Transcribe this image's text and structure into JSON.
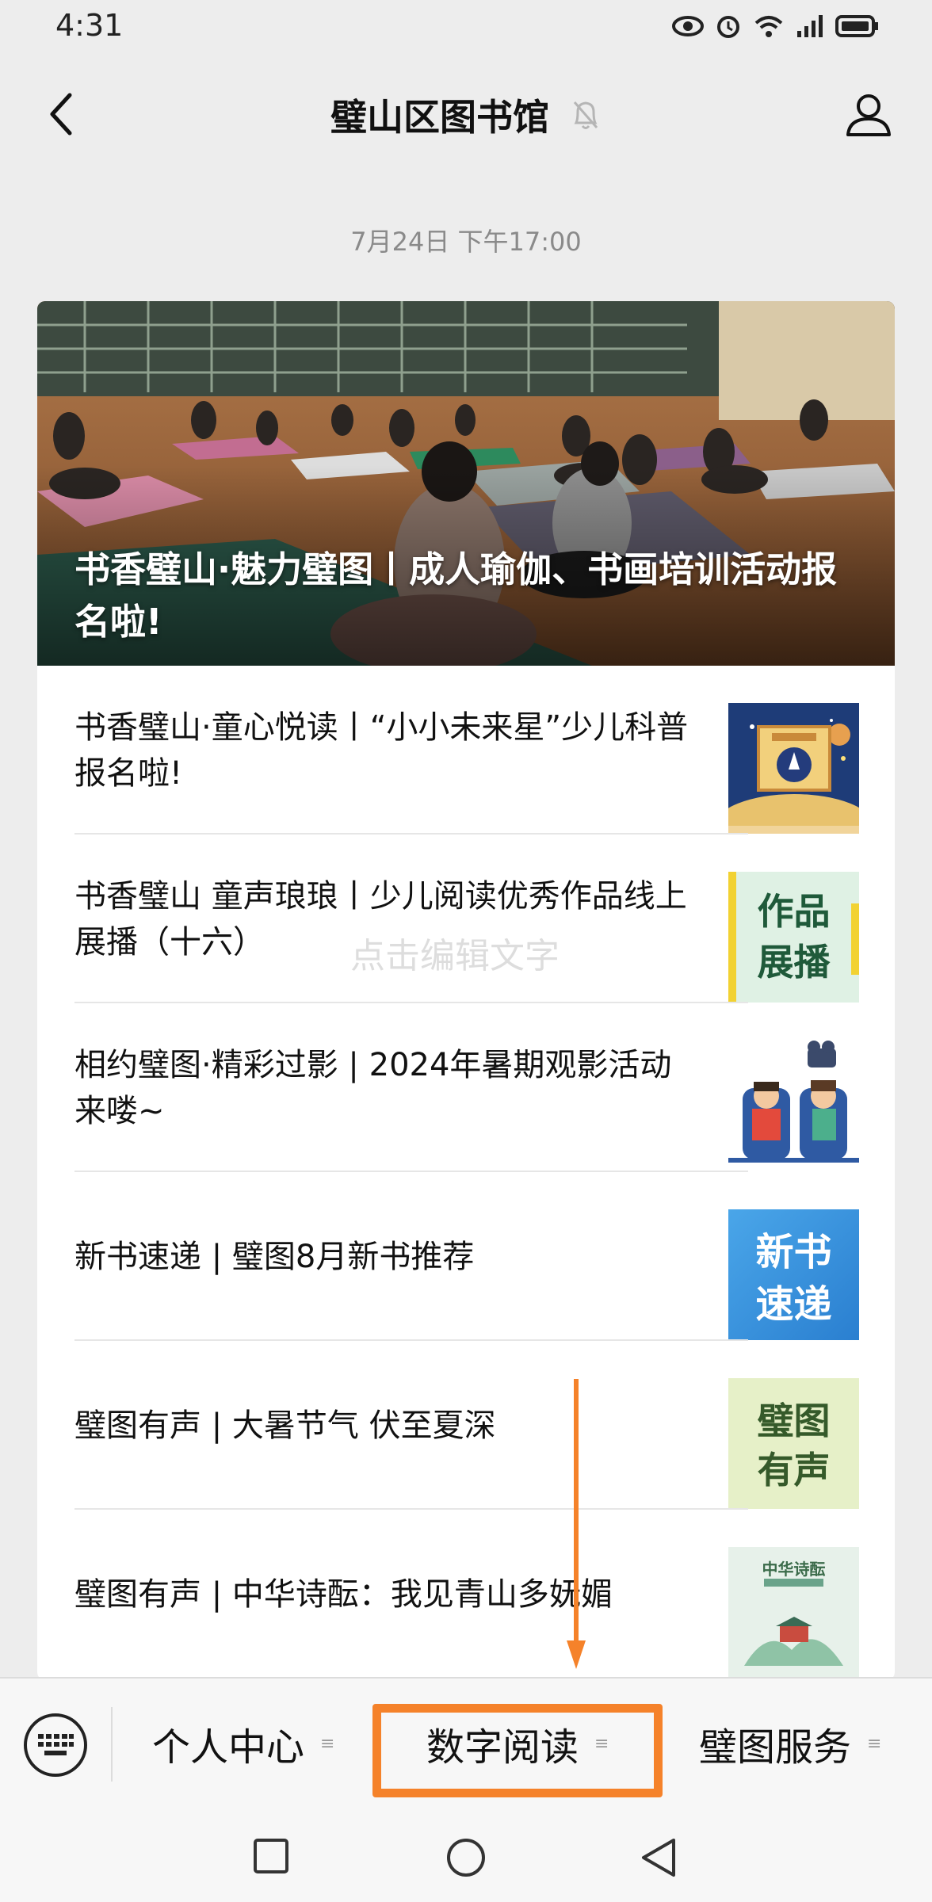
{
  "status_bar": {
    "time": "4:31"
  },
  "header": {
    "title": "璧山区图书馆"
  },
  "timestamp": "7月24日 下午17:00",
  "hero": {
    "title": "书香璧山·魅力璧图丨成人瑜伽、书画培训活动报名啦!"
  },
  "articles": [
    {
      "title": "书香璧山·童心悦读丨“小小未来星”少儿科普报名啦!"
    },
    {
      "title": "书香璧山 童声琅琅丨少儿阅读优秀作品线上展播（十六）",
      "thumb_text": [
        "作品",
        "展播"
      ]
    },
    {
      "title": "相约璧图·精彩过影 | 2024年暑期观影活动来喽~"
    },
    {
      "title": "新书速递 | 璧图8月新书推荐",
      "thumb_text": [
        "新书",
        "速递"
      ]
    },
    {
      "title": "璧图有声 | 大暑节气 伏至夏深",
      "thumb_text": [
        "璧图",
        "有声"
      ]
    },
    {
      "title": "璧图有声 | 中华诗酝：我见青山多妩媚",
      "thumb_text": [
        "中华诗酝"
      ]
    }
  ],
  "overlay_hint": "点击编辑文字",
  "menu": {
    "items": [
      {
        "label": "个人中心"
      },
      {
        "label": "数字阅读"
      },
      {
        "label": "璧图服务"
      }
    ]
  },
  "colors": {
    "highlight": "#f5822a",
    "background": "#ededed"
  },
  "icons": [
    "back-arrow-icon",
    "mute-bell-icon",
    "profile-icon",
    "keyboard-icon",
    "eye-icon",
    "alarm-icon",
    "wifi-icon",
    "signal-icon",
    "battery-icon"
  ]
}
